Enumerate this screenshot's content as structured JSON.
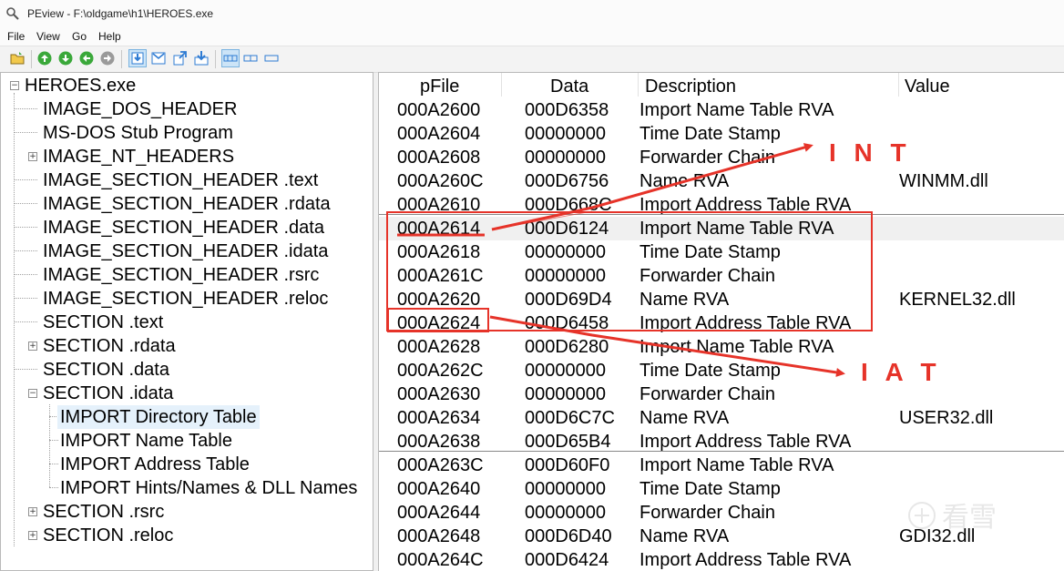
{
  "window": {
    "title": "PEview - F:\\oldgame\\h1\\HEROES.exe"
  },
  "menu": [
    "File",
    "View",
    "Go",
    "Help"
  ],
  "toolbar": {
    "icons": [
      "open-folder-icon",
      "back-icon",
      "forward-icon",
      "up-icon",
      "refresh-icon",
      "view-struct-icon",
      "view-hex-icon",
      "view-export-icon",
      "view-import-icon",
      "view-details-icon",
      "view-list-icon",
      "view-small-icon"
    ],
    "accent": "#2e7bd3",
    "green": "#3aa83a"
  },
  "tree": {
    "root": "HEROES.exe",
    "items": [
      "IMAGE_DOS_HEADER",
      "MS-DOS Stub Program",
      "IMAGE_NT_HEADERS",
      "IMAGE_SECTION_HEADER .text",
      "IMAGE_SECTION_HEADER .rdata",
      "IMAGE_SECTION_HEADER .data",
      "IMAGE_SECTION_HEADER .idata",
      "IMAGE_SECTION_HEADER .rsrc",
      "IMAGE_SECTION_HEADER .reloc",
      "SECTION .text",
      "SECTION .rdata",
      "SECTION .data",
      "SECTION .idata"
    ],
    "children": [
      "IMPORT Directory Table",
      "IMPORT Name Table",
      "IMPORT Address Table",
      "IMPORT Hints/Names & DLL Names"
    ],
    "tail": [
      "SECTION .rsrc",
      "SECTION .reloc"
    ]
  },
  "columns": [
    "pFile",
    "Data",
    "Description",
    "Value"
  ],
  "rows": [
    [
      "000A2600",
      "000D6358",
      "Import Name Table RVA",
      ""
    ],
    [
      "000A2604",
      "00000000",
      "Time Date Stamp",
      ""
    ],
    [
      "000A2608",
      "00000000",
      "Forwarder Chain",
      ""
    ],
    [
      "000A260C",
      "000D6756",
      "Name RVA",
      "WINMM.dll"
    ],
    [
      "000A2610",
      "000D668C",
      "Import Address Table RVA",
      ""
    ],
    [
      "000A2614",
      "000D6124",
      "Import Name Table RVA",
      ""
    ],
    [
      "000A2618",
      "00000000",
      "Time Date Stamp",
      ""
    ],
    [
      "000A261C",
      "00000000",
      "Forwarder Chain",
      ""
    ],
    [
      "000A2620",
      "000D69D4",
      "Name RVA",
      "KERNEL32.dll"
    ],
    [
      "000A2624",
      "000D6458",
      "Import Address Table RVA",
      ""
    ],
    [
      "000A2628",
      "000D6280",
      "Import Name Table RVA",
      ""
    ],
    [
      "000A262C",
      "00000000",
      "Time Date Stamp",
      ""
    ],
    [
      "000A2630",
      "00000000",
      "Forwarder Chain",
      ""
    ],
    [
      "000A2634",
      "000D6C7C",
      "Name RVA",
      "USER32.dll"
    ],
    [
      "000A2638",
      "000D65B4",
      "Import Address Table RVA",
      ""
    ],
    [
      "000A263C",
      "000D60F0",
      "Import Name Table RVA",
      ""
    ],
    [
      "000A2640",
      "00000000",
      "Time Date Stamp",
      ""
    ],
    [
      "000A2644",
      "00000000",
      "Forwarder Chain",
      ""
    ],
    [
      "000A2648",
      "000D6D40",
      "Name RVA",
      "GDI32.dll"
    ],
    [
      "000A264C",
      "000D6424",
      "Import Address Table RVA",
      ""
    ]
  ],
  "annotations": {
    "int_label": "I N T",
    "iat_label": "I A T",
    "color": "#e63329"
  },
  "watermark": "看雪"
}
